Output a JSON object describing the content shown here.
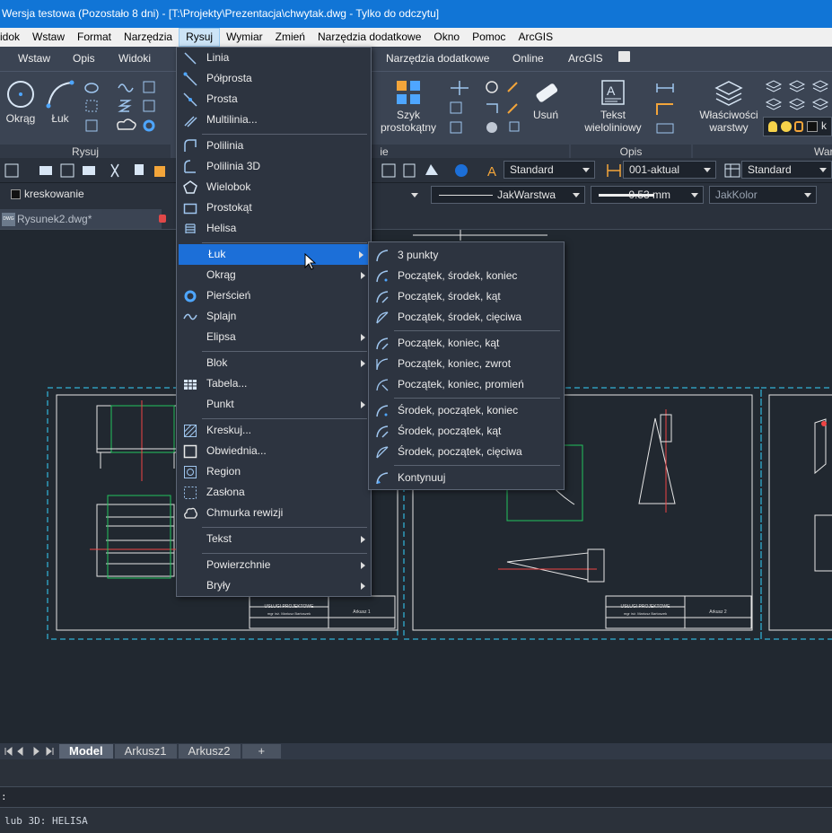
{
  "titlebar": {
    "text": "Wersja testowa (Pozostało 8 dni) - [T:\\Projekty\\Prezentacja\\chwytak.dwg - Tylko do odczytu]"
  },
  "menubar": [
    "idok",
    "Wstaw",
    "Format",
    "Narzędzia",
    "Rysuj",
    "Wymiar",
    "Zmień",
    "Narzędzia dodatkowe",
    "Okno",
    "Pomoc",
    "ArcGIS"
  ],
  "ribbon_tabs": [
    "Wstaw",
    "Opis",
    "Widoki",
    "Narzędzia dodatkowe",
    "Online",
    "ArcGIS"
  ],
  "ribbon": {
    "okrag": "Okrąg",
    "luk": "Łuk",
    "panel_rysuj": "Rysuj",
    "panel_ie": "ie",
    "szyk": "Szyk",
    "szyk2": "prostokątny",
    "usun": "Usuń",
    "tekst": "Tekst",
    "tekst2": "wieloliniowy",
    "panel_opis": "Opis",
    "wlasciwosci": "Właściwości",
    "wlasciwosci2": "warstwy",
    "panel_war": "War",
    "war_short": "k"
  },
  "toolbar": {
    "text_style": "Standard",
    "dim_style": "001-aktual",
    "table_style": "Standard"
  },
  "propbar": {
    "layer": "kreskowanie",
    "linetype": "JakWarstwa",
    "lineweight": "0.53 mm",
    "color": "JakKolor"
  },
  "doc_tab": {
    "label": "Rysunek2.dwg*",
    "badge": "DWG"
  },
  "draw_menu": {
    "items": [
      {
        "label": "Linia",
        "icon": "line-icon",
        "submenu": false
      },
      {
        "label": "Półprosta",
        "icon": "ray-icon",
        "submenu": false
      },
      {
        "label": "Prosta",
        "icon": "xline-icon",
        "submenu": false
      },
      {
        "label": "Multilinia...",
        "icon": "multiline-icon",
        "submenu": false
      },
      {
        "label": "Polilinia",
        "icon": "polyline-icon",
        "submenu": false
      },
      {
        "label": "Polilinia 3D",
        "icon": "polyline3d-icon",
        "submenu": false
      },
      {
        "label": "Wielobok",
        "icon": "polygon-icon",
        "submenu": false
      },
      {
        "label": "Prostokąt",
        "icon": "rectangle-icon",
        "submenu": false
      },
      {
        "label": "Helisa",
        "icon": "helix-icon",
        "submenu": false
      },
      {
        "label": "Łuk",
        "icon": "arc-icon",
        "submenu": true
      },
      {
        "label": "Okrąg",
        "icon": "circle-icon",
        "submenu": true
      },
      {
        "label": "Pierścień",
        "icon": "donut-icon",
        "submenu": false
      },
      {
        "label": "Splajn",
        "icon": "spline-icon",
        "submenu": false
      },
      {
        "label": "Elipsa",
        "icon": "ellipse-icon",
        "submenu": true
      },
      {
        "label": "Blok",
        "icon": "block-icon",
        "submenu": true
      },
      {
        "label": "Tabela...",
        "icon": "table-icon",
        "submenu": false
      },
      {
        "label": "Punkt",
        "icon": "point-icon",
        "submenu": true
      },
      {
        "label": "Kreskuj...",
        "icon": "hatch-icon",
        "submenu": false
      },
      {
        "label": "Obwiednia...",
        "icon": "boundary-icon",
        "submenu": false
      },
      {
        "label": "Region",
        "icon": "region-icon",
        "submenu": false
      },
      {
        "label": "Zasłona",
        "icon": "wipeout-icon",
        "submenu": false
      },
      {
        "label": "Chmurka rewizji",
        "icon": "revcloud-icon",
        "submenu": false
      },
      {
        "label": "Tekst",
        "icon": "text-icon",
        "submenu": true
      },
      {
        "label": "Powierzchnie",
        "icon": "surfaces-icon",
        "submenu": true
      },
      {
        "label": "Bryły",
        "icon": "solids-icon",
        "submenu": true
      }
    ]
  },
  "arc_submenu": {
    "items": [
      "3 punkty",
      "Początek, środek, koniec",
      "Początek, środek, kąt",
      "Początek, środek, cięciwa",
      "Początek, koniec, kąt",
      "Początek, koniec, zwrot",
      "Początek, koniec, promień",
      "Środek, początek, koniec",
      "Środek, początek, kąt",
      "Środek, początek, cięciwa",
      "Kontynuuj"
    ]
  },
  "sheets": [
    {
      "title": "USŁUGI PROJEKTOWE",
      "sub": "mgr inż. Mariusz Bartoszek",
      "sheet": "Arkusz 1"
    },
    {
      "title": "USŁUGI PROJEKTOWE",
      "sub": "mgr inż. Mariusz Bartoszek",
      "sheet": "Arkusz 2"
    }
  ],
  "layout_tabs": [
    "Model",
    "Arkusz1",
    "Arkusz2",
    "+"
  ],
  "command": {
    "prompt": ":",
    "history": "lub 3D: HELISA"
  },
  "colors": {
    "accent": "#1c6fd8",
    "titlebar": "#1175d6",
    "canvas": "#212830"
  }
}
